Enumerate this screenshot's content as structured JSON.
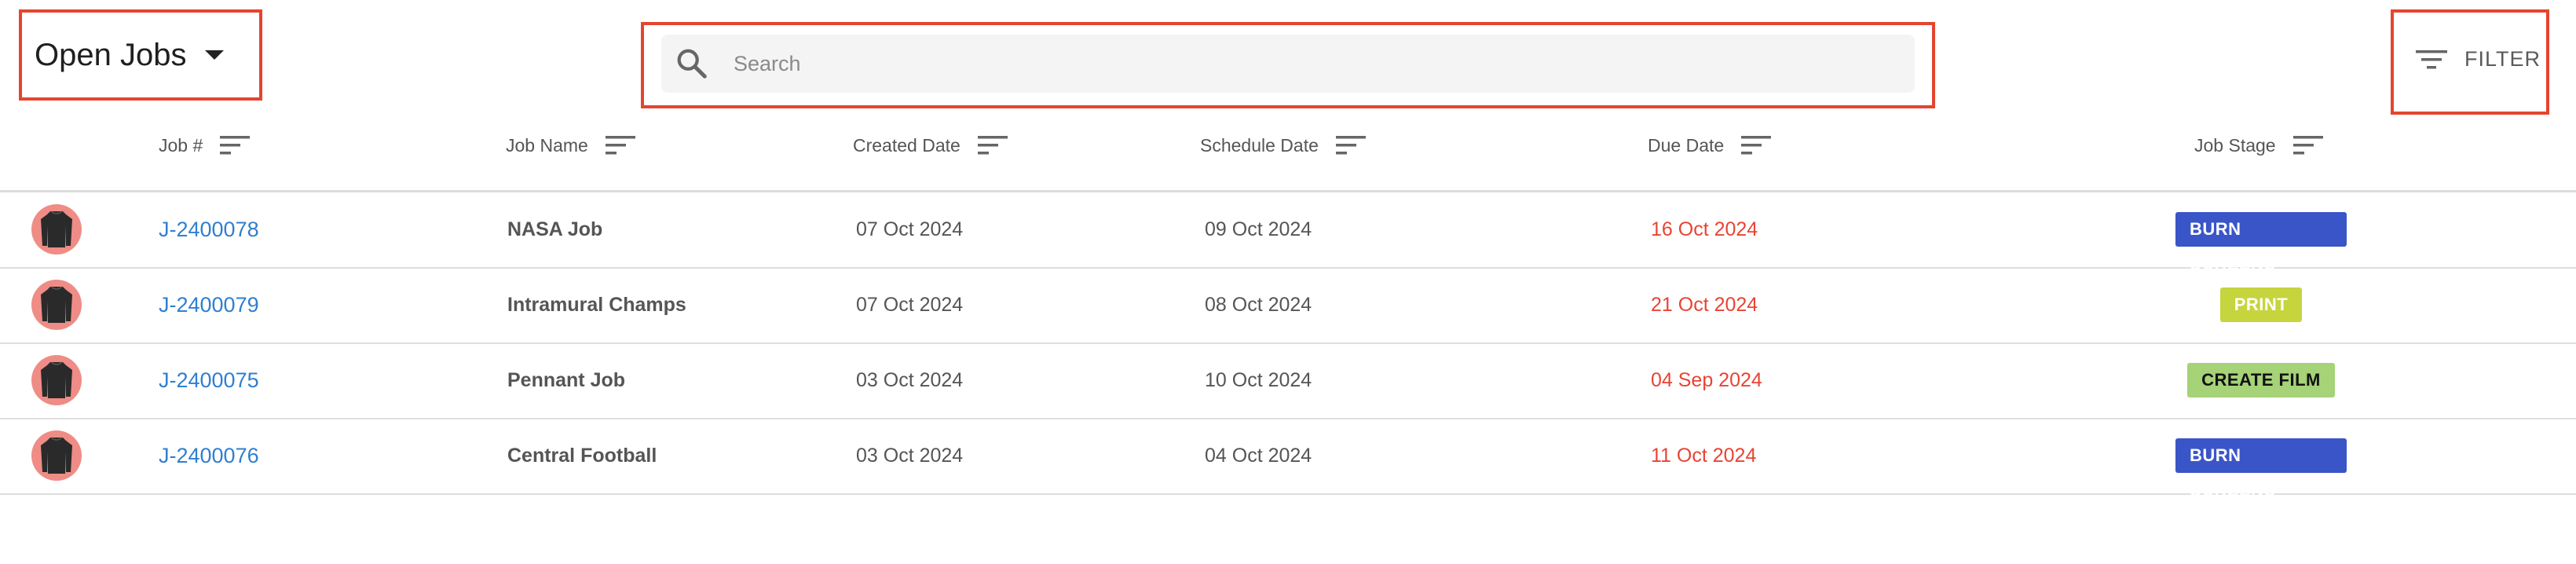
{
  "view": {
    "label": "Open Jobs"
  },
  "search": {
    "placeholder": "Search"
  },
  "filter": {
    "label": "FILTER"
  },
  "columns": {
    "job_number": "Job #",
    "job_name": "Job Name",
    "created_date": "Created Date",
    "schedule_date": "Schedule Date",
    "due_date": "Due Date",
    "job_stage": "Job Stage"
  },
  "rows": [
    {
      "job_number": "J-2400078",
      "job_name": "NASA Job",
      "created_date": "07 Oct 2024",
      "schedule_date": "09 Oct 2024",
      "due_date": "16 Oct 2024",
      "job_stage": "BURN SCREENS"
    },
    {
      "job_number": "J-2400079",
      "job_name": "Intramural Champs",
      "created_date": "07 Oct 2024",
      "schedule_date": "08 Oct 2024",
      "due_date": "21 Oct 2024",
      "job_stage": "PRINT"
    },
    {
      "job_number": "J-2400075",
      "job_name": "Pennant Job",
      "created_date": "03 Oct 2024",
      "schedule_date": "10 Oct 2024",
      "due_date": "04 Sep 2024",
      "job_stage": "CREATE FILM"
    },
    {
      "job_number": "J-2400076",
      "job_name": "Central Football",
      "created_date": "03 Oct 2024",
      "schedule_date": "04 Oct 2024",
      "due_date": "11 Oct 2024",
      "job_stage": "BURN SCREENS"
    }
  ],
  "colors": {
    "highlight_border": "#e4452f",
    "link": "#2f7fd0",
    "due_date": "#e84434",
    "stage_burn_screens": "#3a55c8",
    "stage_print": "#c6d43e",
    "stage_create_film": "#a6d278",
    "avatar_bg": "#ef8c86"
  },
  "icons": {
    "view_caret": "caret-down-icon",
    "search": "search-icon",
    "filter": "filter-icon",
    "sort": "sort-icon",
    "avatar": "shirt-icon"
  }
}
